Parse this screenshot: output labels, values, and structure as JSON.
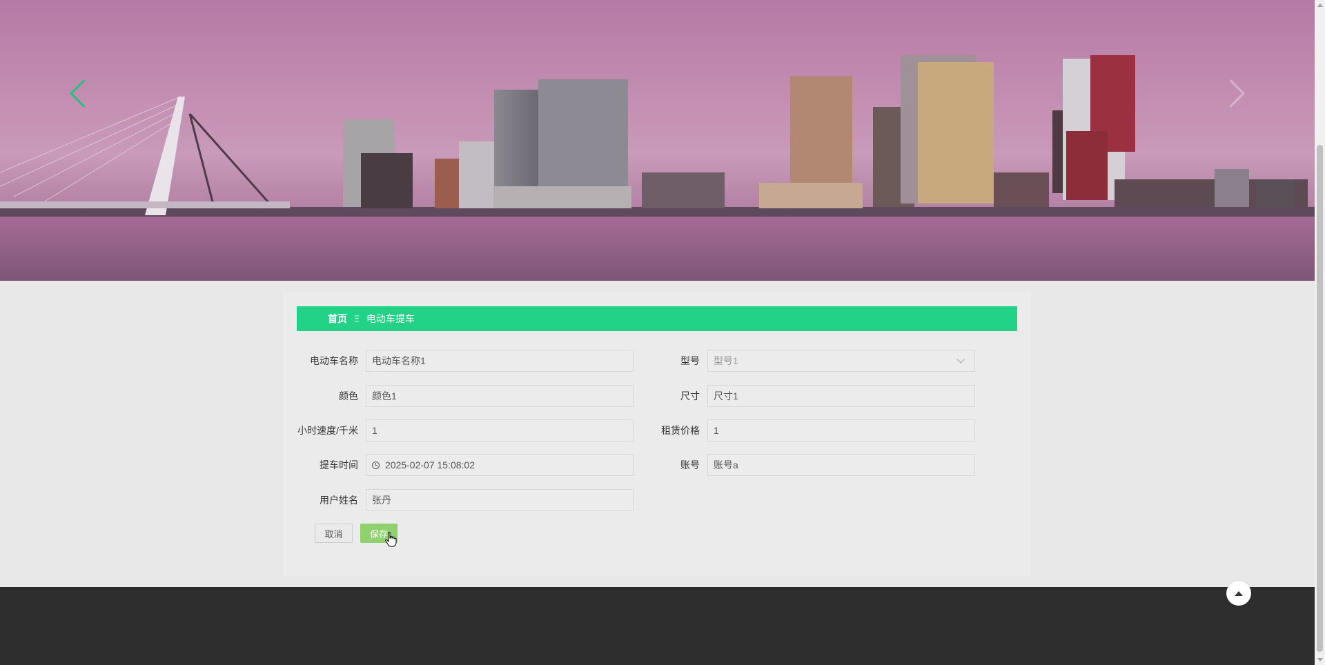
{
  "banner": {
    "prev_icon": "chevron-left-icon",
    "next_icon": "chevron-right-icon"
  },
  "breadcrumb": {
    "home": "首页",
    "separator": "Ξ",
    "current": "电动车提车"
  },
  "form": {
    "name": {
      "label": "电动车名称",
      "value": "电动车名称1"
    },
    "model": {
      "label": "型号",
      "value": "型号1"
    },
    "color": {
      "label": "颜色",
      "value": "颜色1"
    },
    "size": {
      "label": "尺寸",
      "value": "尺寸1"
    },
    "speed": {
      "label": "小时速度/千米",
      "value": "1"
    },
    "price": {
      "label": "租赁价格",
      "value": "1"
    },
    "pickup_time": {
      "label": "提车时间",
      "value": "2025-02-07 15:08:02"
    },
    "account": {
      "label": "账号",
      "value": "账号a"
    },
    "username": {
      "label": "用户姓名",
      "value": "张丹"
    }
  },
  "buttons": {
    "cancel": "取消",
    "save": "保存"
  },
  "colors": {
    "accent": "#22d286",
    "save_button": "#8fd16e",
    "footer": "#2e2e2e"
  }
}
